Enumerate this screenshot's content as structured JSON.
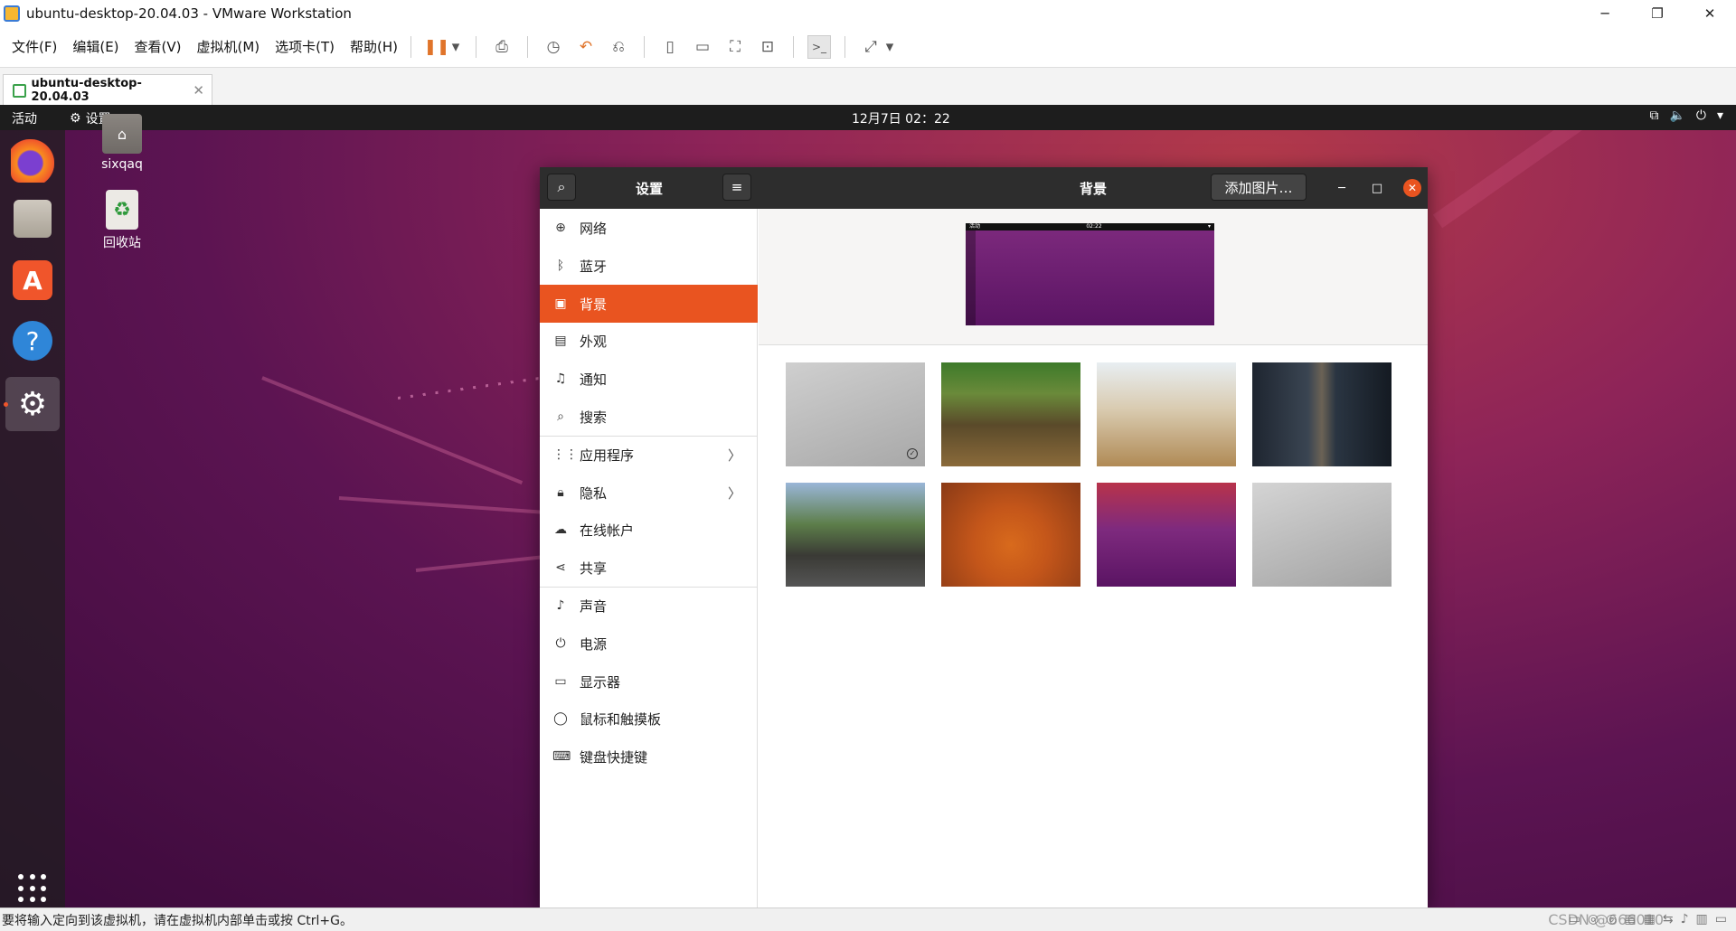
{
  "window": {
    "title": "ubuntu-desktop-20.04.03 - VMware Workstation",
    "controls": {
      "minimize": "─",
      "restore": "❐",
      "close": "✕"
    }
  },
  "menu": [
    {
      "label": "文件(F)"
    },
    {
      "label": "编辑(E)"
    },
    {
      "label": "查看(V)"
    },
    {
      "label": "虚拟机(M)"
    },
    {
      "label": "选项卡(T)"
    },
    {
      "label": "帮助(H)"
    }
  ],
  "toolbar": {
    "pause": "❚❚",
    "dropdown": "▾",
    "send_ctrl_alt_del": "⎙",
    "snapshot": "◷",
    "revert": "↶",
    "manage_snapshots": "⎌",
    "view_sidebar": "▯",
    "view_thumbs": "▭",
    "fullscreen": "⛶",
    "unity": "⊡",
    "console": ">_",
    "stretch": "⤢"
  },
  "tab": {
    "label": "ubuntu-desktop-20.04.03",
    "close": "✕"
  },
  "ubuntu_panel": {
    "activities": "活动",
    "app_menu": "设置",
    "app_menu_arrow": "▾",
    "clock": "12月7日  02：22",
    "tray": {
      "network": "⧉",
      "volume": "🔈",
      "power": "⏻",
      "menu": "▾"
    }
  },
  "desktop_icons": [
    {
      "label": "sixqaq"
    },
    {
      "label": "回收站"
    }
  ],
  "settings_window": {
    "left_title": "设置",
    "right_title": "背景",
    "add_picture_button": "添加图片…",
    "search_glyph": "⌕",
    "menu_glyph": "≡",
    "wm_minimize": "─",
    "wm_maximize": "□",
    "wm_close": "✕"
  },
  "sidebar": {
    "items": [
      {
        "label": "网络",
        "icon": "⊕",
        "icon_name": "network-icon"
      },
      {
        "label": "蓝牙",
        "icon": "ᛒ",
        "icon_name": "bluetooth-icon"
      },
      {
        "label": "背景",
        "icon": "▣",
        "icon_name": "background-icon",
        "selected": true
      },
      {
        "label": "外观",
        "icon": "▤",
        "icon_name": "appearance-icon"
      },
      {
        "label": "通知",
        "icon": "♫",
        "icon_name": "bell-icon"
      },
      {
        "label": "搜索",
        "icon": "⌕",
        "icon_name": "search-icon"
      },
      {
        "label": "应用程序",
        "icon": "⋮⋮",
        "icon_name": "apps-grid-icon",
        "has_arrow": true
      },
      {
        "label": "隐私",
        "icon": "🔒︎",
        "icon_name": "lock-icon",
        "has_arrow": true
      },
      {
        "label": "在线帐户",
        "icon": "☁",
        "icon_name": "cloud-icon"
      },
      {
        "label": "共享",
        "icon": "⋖",
        "icon_name": "share-icon"
      },
      {
        "label": "声音",
        "icon": "♪",
        "icon_name": "music-note-icon"
      },
      {
        "label": "电源",
        "icon": "⏻",
        "icon_name": "power-icon"
      },
      {
        "label": "显示器",
        "icon": "▭",
        "icon_name": "display-icon"
      },
      {
        "label": "鼠标和触摸板",
        "icon": "◯",
        "icon_name": "mouse-icon"
      },
      {
        "label": "键盘快捷键",
        "icon": "⌨",
        "icon_name": "keyboard-icon"
      }
    ],
    "arrow_glyph": "〉"
  },
  "preview": {
    "panel_left": "活动",
    "panel_clock": "02:22"
  },
  "wallpapers": [
    {
      "name": "warty-final-gray",
      "selected": true
    },
    {
      "name": "forest-trees"
    },
    {
      "name": "table-balls"
    },
    {
      "name": "subway-tunnel"
    },
    {
      "name": "wooden-bridge"
    },
    {
      "name": "orange-seahorse"
    },
    {
      "name": "focal-fossa-purple"
    },
    {
      "name": "focal-fossa-gray"
    }
  ],
  "status_bar": {
    "message": "要将输入定向到该虚拟机，请在虚拟机内部单击或按 Ctrl+G。",
    "watermark": "CSDN @666010"
  },
  "colors": {
    "accent": "#E95420",
    "vm_accent": "#E0742A",
    "headerbar": "#2D2D2D",
    "panel": "#1D1D1D"
  }
}
